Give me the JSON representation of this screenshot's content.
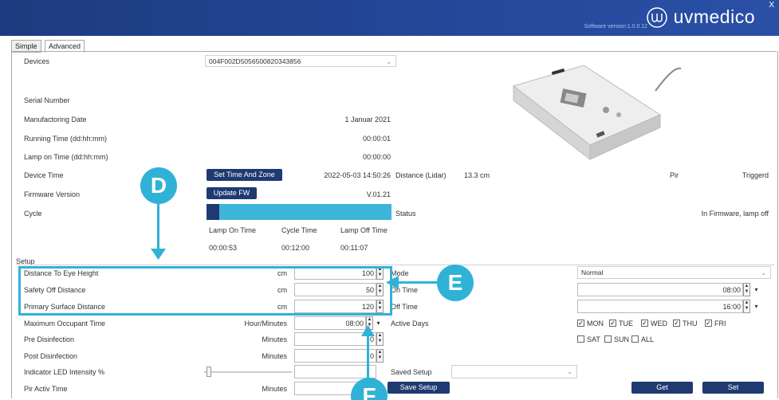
{
  "header": {
    "close": "X",
    "software_version": "Software version:1.0.0.12",
    "logo_text": "uvmedico"
  },
  "tabs": [
    {
      "label": "Simple",
      "active": false
    },
    {
      "label": "Advanced",
      "active": true
    }
  ],
  "devices": {
    "label": "Devices",
    "selected": "004F002D5056500820343856"
  },
  "info": {
    "serial_label": "Serial Number",
    "manufacturing_label": "Manufactoring Date",
    "manufacturing_value": "1 Januar 2021",
    "running_label": "Running Time (dd:hh:mm)",
    "running_value": "00:00:01",
    "lamp_on_label": "Lamp on Time (dd:hh:mm)",
    "lamp_on_value": "00:00:00",
    "device_time_label": "Device Time",
    "set_time_button": "Set Time And Zone",
    "device_time_value": "2022-05-03 14:50:26",
    "distance_label": "Distance (Lidar)",
    "distance_value": "13.3 cm",
    "pir_label": "Pir",
    "pir_value": "Triggerd",
    "firmware_label": "Firmware Version",
    "update_fw_button": "Update FW",
    "firmware_value": "V.01.21",
    "cycle_label": "Cycle",
    "status_label": "Status",
    "status_value": "In Firmware, lamp off"
  },
  "cycle": {
    "progress": 0.07,
    "headers": [
      "Lamp On Time",
      "Cycle Time",
      "Lamp Off Time"
    ],
    "values": [
      "00:00:53",
      "00:12:00",
      "00:11:07"
    ]
  },
  "setup": {
    "title": "Setup",
    "rows": [
      {
        "label": "Distance To Eye Height",
        "unit": "cm",
        "value": "100"
      },
      {
        "label": "Safety Off Distance",
        "unit": "cm",
        "value": "50"
      },
      {
        "label": "Primary Surface Distance",
        "unit": "cm",
        "value": "120"
      },
      {
        "label": "Maximum Occupant Time",
        "unit": "Hour/Minutes",
        "value": "08:00"
      },
      {
        "label": "Pre Disinfection",
        "unit": "Minutes",
        "value": "0"
      },
      {
        "label": "Post Disinfection",
        "unit": "Minutes",
        "value": "0"
      },
      {
        "label": "Indicator LED Intensity %",
        "unit": "",
        "value": ""
      },
      {
        "label": "Pir Activ Time",
        "unit": "Minutes",
        "value": ""
      }
    ],
    "led_intensity": 0.03,
    "mode_label": "Mode",
    "mode_value": "Normal",
    "on_time_label": "On Time",
    "on_time_value": "08:00",
    "off_time_label": "Off Time",
    "off_time_value": "16:00",
    "active_days_label": "Active Days",
    "days": [
      {
        "label": "MON",
        "checked": true
      },
      {
        "label": "TUE",
        "checked": true
      },
      {
        "label": "WED",
        "checked": true
      },
      {
        "label": "THU",
        "checked": true
      },
      {
        "label": "FRI",
        "checked": true
      },
      {
        "label": "SAT",
        "checked": false
      },
      {
        "label": "SUN",
        "checked": false
      },
      {
        "label": "ALL",
        "checked": false
      }
    ],
    "saved_setup_label": "Saved Setup",
    "save_setup_button": "Save Setup",
    "get_button": "Get",
    "set_button": "Set"
  },
  "annotations": {
    "d": "D",
    "e": "E",
    "f": "F"
  },
  "colors": {
    "header": "#24489a",
    "accent": "#30b2d6",
    "button": "#1f3a72"
  }
}
